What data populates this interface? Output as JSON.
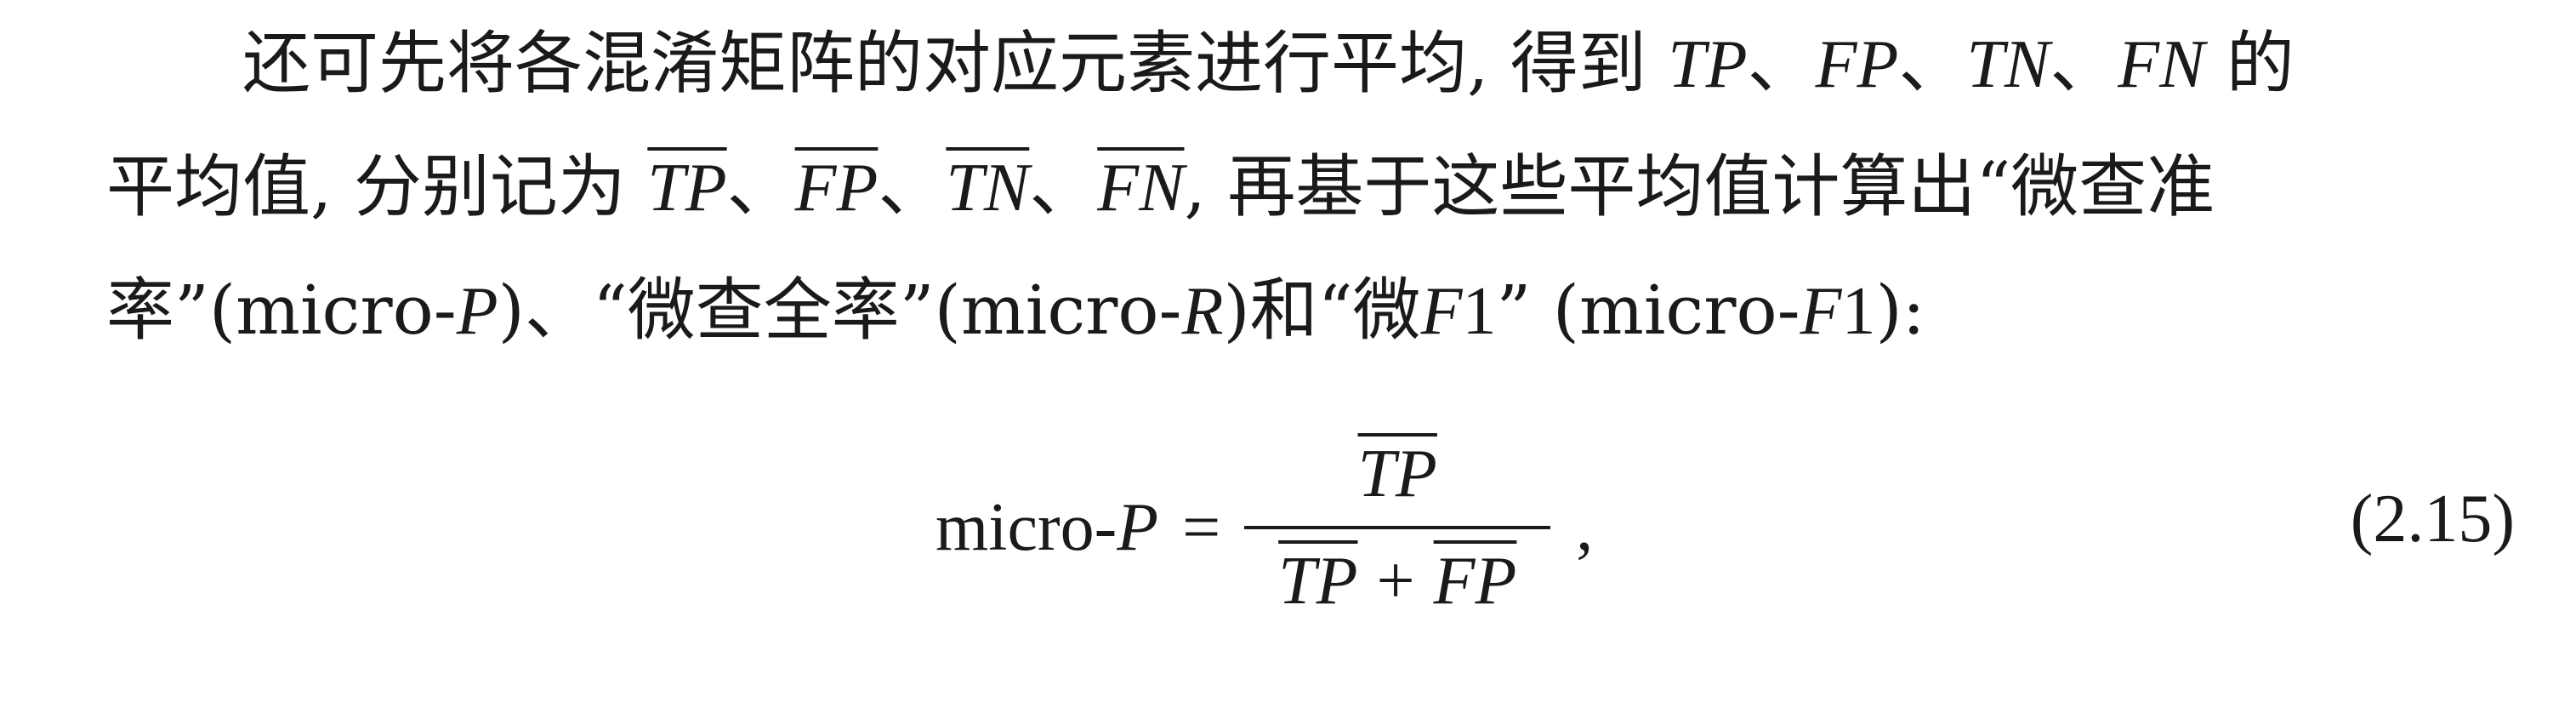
{
  "paragraph": {
    "line1": {
      "t1": "还可先将各混淆矩阵的对应元素进行平均, 得到 ",
      "TP": "TP",
      "s1": "、",
      "FP": "FP",
      "s2": "、",
      "TN": "TN",
      "s3": "、",
      "FN": "FN",
      "t2": " 的"
    },
    "line2": {
      "t1": "平均值, 分别记为 ",
      "TP": "TP",
      "s1": "、",
      "FP": "FP",
      "s2": "、",
      "TN": "TN",
      "s3": "、",
      "FN": "FN",
      "t2": ", 再基于这些平均值计算出“微查准"
    },
    "line3": {
      "t1": "率”(micro-",
      "P": "P",
      "t2": ")、“微查全率”(micro-",
      "R": "R",
      "t3": ")和“微",
      "F1a": "F",
      "one_a": "1",
      "t4": "” (micro-",
      "F1b": "F",
      "one_b": "1",
      "t5": "):"
    }
  },
  "equation": {
    "lhs_prefix": "micro-",
    "lhs_var": "P",
    "equals": "=",
    "numerator": "TP",
    "den_left": "TP",
    "plus": "+",
    "den_right": "FP",
    "trailing": ",",
    "number": "(2.15)"
  }
}
